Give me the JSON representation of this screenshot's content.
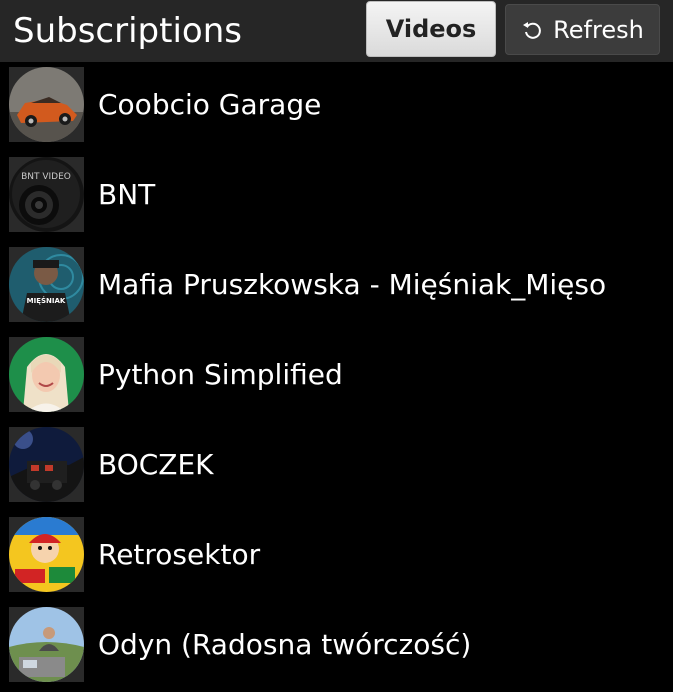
{
  "header": {
    "title": "Subscriptions",
    "videos_label": "Videos",
    "refresh_label": "Refresh"
  },
  "subscriptions": [
    {
      "name": "Coobcio Garage"
    },
    {
      "name": "BNT",
      "avatar_text": "BNT VIDEO"
    },
    {
      "name": "Mafia Pruszkowska - Mięśniak_Mięso",
      "avatar_text": "MIĘŚNIAK"
    },
    {
      "name": "Python Simplified"
    },
    {
      "name": "BOCZEK"
    },
    {
      "name": "Retrosektor"
    },
    {
      "name": "Odyn (Radosna twórczość)"
    }
  ],
  "colors": {
    "background": "#000000",
    "header": "#262626",
    "videos_button": "#e8e8e8",
    "refresh_button": "#3c3c3c"
  }
}
